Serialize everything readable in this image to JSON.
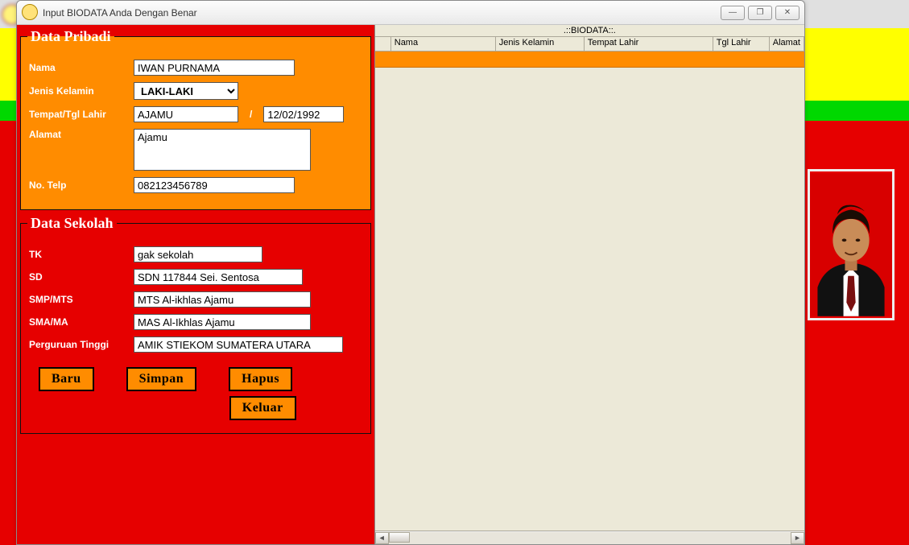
{
  "window": {
    "title": "Input BIODATA Anda Dengan Benar",
    "controls": {
      "min": "—",
      "max": "❐",
      "close": "✕"
    }
  },
  "personal": {
    "legend": "Data Pribadi",
    "labels": {
      "nama": "Nama",
      "jk": "Jenis Kelamin",
      "ttl": "Tempat/Tgl Lahir",
      "alamat": "Alamat",
      "telp": "No. Telp"
    },
    "values": {
      "nama": "IWAN PURNAMA",
      "jk": "LAKI-LAKI",
      "tempat": "AJAMU",
      "tgl": "12/02/1992",
      "alamat": "Ajamu",
      "telp": "082123456789"
    },
    "slash": "/"
  },
  "school": {
    "legend": "Data Sekolah",
    "labels": {
      "tk": "TK",
      "sd": "SD",
      "smp": "SMP/MTS",
      "sma": "SMA/MA",
      "pt": "Perguruan Tinggi"
    },
    "values": {
      "tk": "gak sekolah",
      "sd": "SDN 117844 Sei. Sentosa",
      "smp": "MTS Al-ikhlas Ajamu",
      "sma": "MAS Al-Ikhlas Ajamu",
      "pt": "AMIK STIEKOM SUMATERA UTARA"
    }
  },
  "buttons": {
    "baru": "Baru",
    "simpan": "Simpan",
    "hapus": "Hapus",
    "keluar": "Keluar"
  },
  "grid": {
    "caption": ".::BIODATA::.",
    "columns": {
      "rowhdr": "",
      "nama": "Nama",
      "jk": "Jenis Kelamin",
      "tempat": "Tempat Lahir",
      "tgl": "Tgl Lahir",
      "alamat": "Alamat"
    }
  },
  "scroll": {
    "left": "◄",
    "right": "►"
  }
}
